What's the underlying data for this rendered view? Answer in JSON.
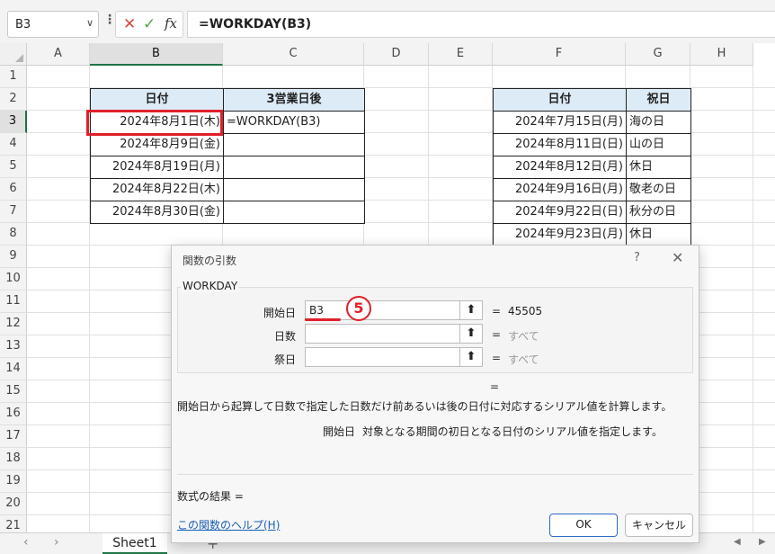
{
  "formula_bar": {
    "name_box": "B3",
    "name_box_arrow": "∨",
    "menu_dots": "⋮",
    "cancel_glyph": "✕",
    "enter_glyph": "✓",
    "fx_label": "fx",
    "formula": "=WORKDAY(B3)"
  },
  "grid": {
    "columns": [
      "A",
      "B",
      "C",
      "D",
      "E",
      "F",
      "G",
      "H"
    ],
    "rows": [
      "1",
      "2",
      "3",
      "4",
      "5",
      "6",
      "7",
      "8",
      "9",
      "10",
      "11",
      "12",
      "13",
      "14",
      "15",
      "16",
      "17",
      "18",
      "19",
      "20",
      "21"
    ],
    "selected_column": "B",
    "selected_row": "3"
  },
  "table_left": {
    "headers": [
      "日付",
      "3営業日後"
    ],
    "rows": [
      [
        "2024年8月1日(木)",
        "=WORKDAY(B3)"
      ],
      [
        "2024年8月9日(金)",
        ""
      ],
      [
        "2024年8月19日(月)",
        ""
      ],
      [
        "2024年8月22日(木)",
        ""
      ],
      [
        "2024年8月30日(金)",
        ""
      ]
    ]
  },
  "table_right": {
    "headers": [
      "日付",
      "祝日"
    ],
    "rows": [
      [
        "2024年7月15日(月)",
        "海の日"
      ],
      [
        "2024年8月11日(日)",
        "山の日"
      ],
      [
        "2024年8月12日(月)",
        "休日"
      ],
      [
        "2024年9月16日(月)",
        "敬老の日"
      ],
      [
        "2024年9月22日(日)",
        "秋分の日"
      ],
      [
        "2024年9月23日(月)",
        "休日"
      ]
    ]
  },
  "sheet_bar": {
    "prev": "‹",
    "next": "›",
    "tab": "Sheet1",
    "add": "+",
    "scroll_left": "◀",
    "scroll_right": "▶"
  },
  "dialog": {
    "title": "関数の引数",
    "help_glyph": "?",
    "close_glyph": "✕",
    "function_name": "WORKDAY",
    "args": [
      {
        "label": "開始日",
        "value": "B3",
        "result": "45505"
      },
      {
        "label": "日数",
        "value": "",
        "result": "すべて"
      },
      {
        "label": "祭日",
        "value": "",
        "result": "すべて"
      }
    ],
    "ref_button": "⬆",
    "equals": "=",
    "annotation": "5",
    "result_equals": "=",
    "description": "開始日から起算して日数で指定した日数だけ前あるいは後の日付に対応するシリアル値を計算します。",
    "arg_desc_name": "開始日",
    "arg_desc_text": "対象となる期間の初日となる日付のシリアル値を指定します。",
    "formula_result_label": "数式の結果 =",
    "help_link": "この関数のヘルプ(H)",
    "ok_label": "OK",
    "cancel_label": "キャンセル"
  }
}
